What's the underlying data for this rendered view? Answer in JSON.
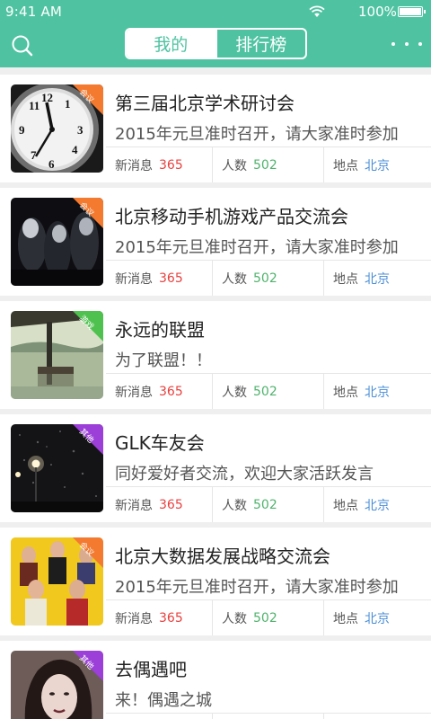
{
  "status_bar": {
    "time": "9:41 AM",
    "battery": "100%"
  },
  "nav": {
    "tabs": [
      {
        "label": "我的",
        "active": true
      },
      {
        "label": "排行榜",
        "active": false
      }
    ],
    "icons": {
      "left": "search-icon",
      "right": "more-icon"
    }
  },
  "colors": {
    "primary": "#4fc3a1",
    "news_count": "#e8403f",
    "people_count": "#4fb36c",
    "location": "#4a8ed6",
    "ribbon_orange": "#f37a2f",
    "ribbon_green": "#4fc14f",
    "ribbon_purple": "#9b3fd8"
  },
  "labels": {
    "news": "新消息",
    "people": "人数",
    "location": "地点"
  },
  "items": [
    {
      "title": "第三届北京学术研讨会",
      "desc": "2015年元旦准时召开，请大家准时参加",
      "news": "365",
      "people": "502",
      "location": "北京",
      "tag": "会议",
      "tag_color": "#f37a2f",
      "image": "clock-photo"
    },
    {
      "title": "北京移动手机游戏产品交流会",
      "desc": "2015年元旦准时召开，请大家准时参加",
      "news": "365",
      "people": "502",
      "location": "北京",
      "tag": "会议",
      "tag_color": "#f37a2f",
      "image": "dark-figures-photo"
    },
    {
      "title": "永远的联盟",
      "desc": "为了联盟！！",
      "news": "365",
      "people": "502",
      "location": "北京",
      "tag": "游戏",
      "tag_color": "#4fc14f",
      "image": "bridge-lake-photo"
    },
    {
      "title": "GLK车友会",
      "desc": "同好爱好者交流，欢迎大家活跃发言",
      "news": "365",
      "people": "502",
      "location": "北京",
      "tag": "其他",
      "tag_color": "#9b3fd8",
      "image": "night-street-lamp-photo"
    },
    {
      "title": "北京大数据发展战略交流会",
      "desc": "2015年元旦准时召开，请大家准时参加",
      "news": "365",
      "people": "502",
      "location": "北京",
      "tag": "会议",
      "tag_color": "#f37a2f",
      "image": "band-group-photo"
    },
    {
      "title": "去偶遇吧",
      "desc": "来！偶遇之城",
      "news": "365",
      "people": "502",
      "location": "北京",
      "tag": "其他",
      "tag_color": "#9b3fd8",
      "image": "woman-portrait-photo"
    }
  ]
}
